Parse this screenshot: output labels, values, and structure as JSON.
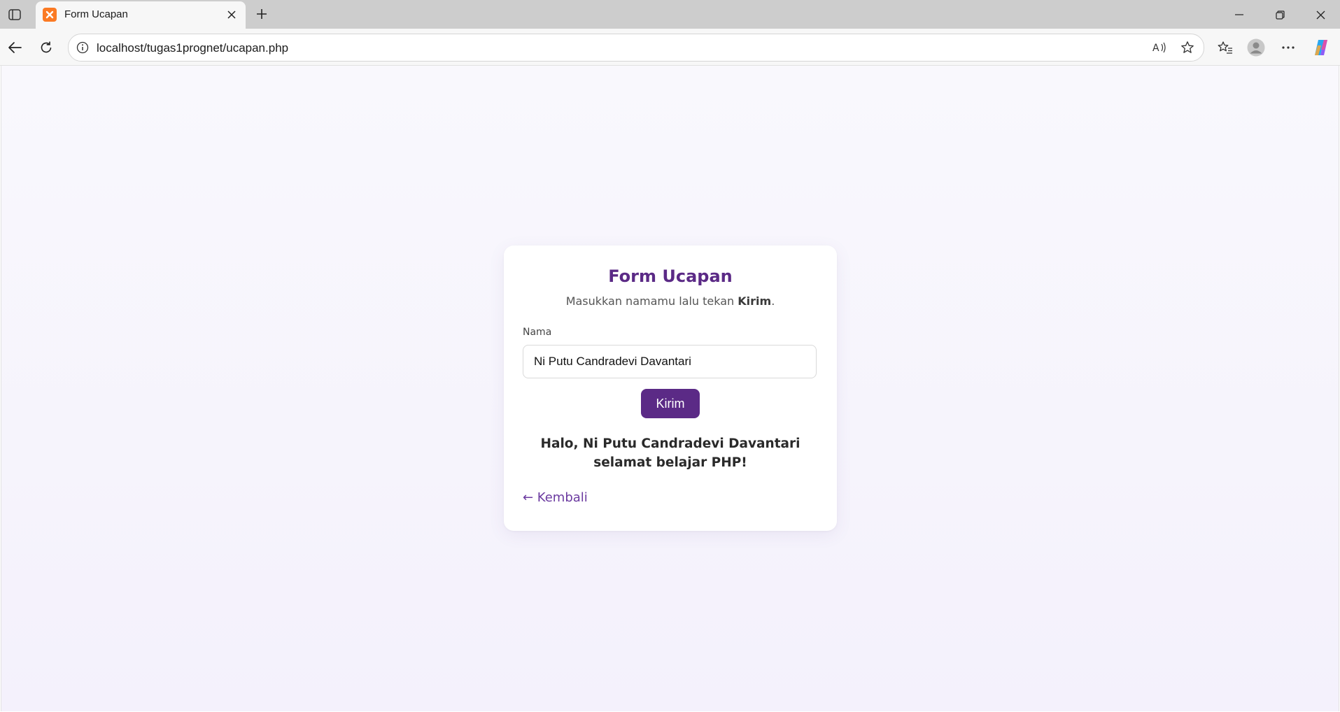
{
  "browser": {
    "tab": {
      "title": "Form Ucapan",
      "favicon": "xampp-icon"
    },
    "address_bar": {
      "url": "localhost/tugas1prognet/ucapan.php"
    },
    "icons": {
      "sidebar": "tab-actions-icon",
      "close_tab": "close-icon",
      "new_tab": "plus-icon",
      "back": "arrow-left-icon",
      "refresh": "refresh-icon",
      "info": "info-icon",
      "read_aloud": "read-aloud-icon",
      "favorite": "star-icon",
      "favorites": "favorites-icon",
      "profile": "avatar-icon",
      "more": "more-icon",
      "copilot": "copilot-icon",
      "minimize": "minimize-icon",
      "restore": "restore-icon",
      "close_window": "close-icon"
    }
  },
  "page": {
    "title": "Form Ucapan",
    "subtitle_prefix": "Masukkan namamu lalu tekan ",
    "subtitle_bold": "Kirim",
    "subtitle_suffix": ".",
    "field_label": "Nama",
    "input_value": "Ni Putu Candradevi Davantari",
    "submit_label": "Kirim",
    "greeting": "Halo, Ni Putu Candradevi Davantari selamat belajar PHP!",
    "back_link": "← Kembali"
  },
  "colors": {
    "accent": "#5b2a86",
    "link": "#6b3aa0",
    "background": "#f6f3fc"
  }
}
